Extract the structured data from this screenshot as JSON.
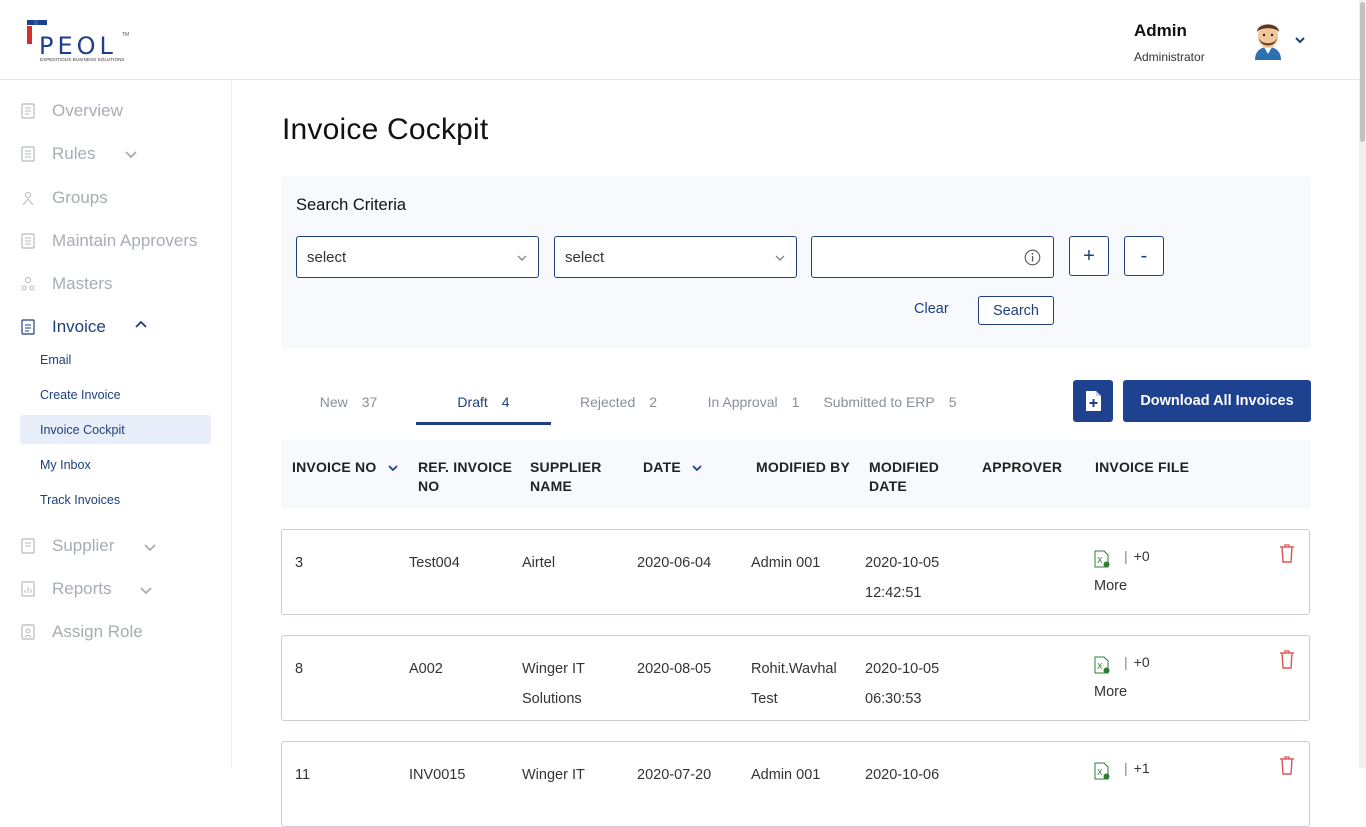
{
  "brand": {
    "name": "PEOL",
    "tm": "TM",
    "tagline": "EXPEDITIOUS BUSINESS SOLUTIONS",
    "primary_color": "#1e4290",
    "accent_color": "#d32f2f"
  },
  "user": {
    "name": "Admin",
    "role": "Administrator"
  },
  "sidebar": {
    "items": [
      {
        "label": "Overview",
        "icon": "document-icon"
      },
      {
        "label": "Rules",
        "icon": "list-icon"
      },
      {
        "label": "Groups",
        "icon": "group-icon"
      },
      {
        "label": "Maintain Approvers",
        "icon": "list-icon"
      },
      {
        "label": "Masters",
        "icon": "hierarchy-icon"
      },
      {
        "label": "Invoice",
        "icon": "invoice-icon"
      },
      {
        "label": "Supplier",
        "icon": "document-icon"
      },
      {
        "label": "Reports",
        "icon": "report-icon"
      },
      {
        "label": "Assign Role",
        "icon": "user-role-icon"
      }
    ],
    "invoice_sub": [
      "Email",
      "Create Invoice",
      "Invoice Cockpit",
      "My Inbox",
      "Track Invoices"
    ]
  },
  "page": {
    "title": "Invoice Cockpit"
  },
  "search": {
    "title": "Search Criteria",
    "select1": "select",
    "select2": "select",
    "value": "",
    "add_label": "+",
    "remove_label": "-",
    "clear_label": "Clear",
    "search_label": "Search"
  },
  "tabs": [
    {
      "label": "New",
      "count": "37"
    },
    {
      "label": "Draft",
      "count": "4"
    },
    {
      "label": "Rejected",
      "count": "2"
    },
    {
      "label": "In Approval",
      "count": "1"
    },
    {
      "label": "Submitted to ERP",
      "count": "5"
    }
  ],
  "actions": {
    "download_all": "Download All Invoices"
  },
  "table": {
    "headers": {
      "invoice_no": "INVOICE NO",
      "ref_invoice_1": "REF. INVOICE",
      "ref_invoice_2": "NO",
      "supplier_1": "SUPPLIER",
      "supplier_2": "NAME",
      "date": "DATE",
      "modified_by": "MODIFIED BY",
      "modified_date_1": "MODIFIED",
      "modified_date_2": "DATE",
      "approver": "APPROVER",
      "invoice_file": "INVOICE FILE"
    },
    "rows": [
      {
        "invoice_no": "3",
        "ref": "Test004",
        "supplier_1": "Airtel",
        "supplier_2": "",
        "date": "2020-06-04",
        "modified_by_1": "Admin 001",
        "modified_by_2": "",
        "mod_date": "2020-10-05",
        "mod_time": "12:42:51",
        "approver": "",
        "file_sep": "|",
        "file_extra": "+0",
        "more": "More"
      },
      {
        "invoice_no": "8",
        "ref": "A002",
        "supplier_1": "Winger IT",
        "supplier_2": "Solutions",
        "date": "2020-08-05",
        "modified_by_1": "Rohit.Wavhal",
        "modified_by_2": "Test",
        "mod_date": "2020-10-05",
        "mod_time": "06:30:53",
        "approver": "",
        "file_sep": "|",
        "file_extra": "+0",
        "more": "More"
      },
      {
        "invoice_no": "11",
        "ref": "INV0015",
        "supplier_1": "Winger IT",
        "supplier_2": "",
        "date": "2020-07-20",
        "modified_by_1": "Admin 001",
        "modified_by_2": "",
        "mod_date": "2020-10-06",
        "mod_time": "",
        "approver": "",
        "file_sep": "|",
        "file_extra": "+1",
        "more": ""
      }
    ]
  }
}
